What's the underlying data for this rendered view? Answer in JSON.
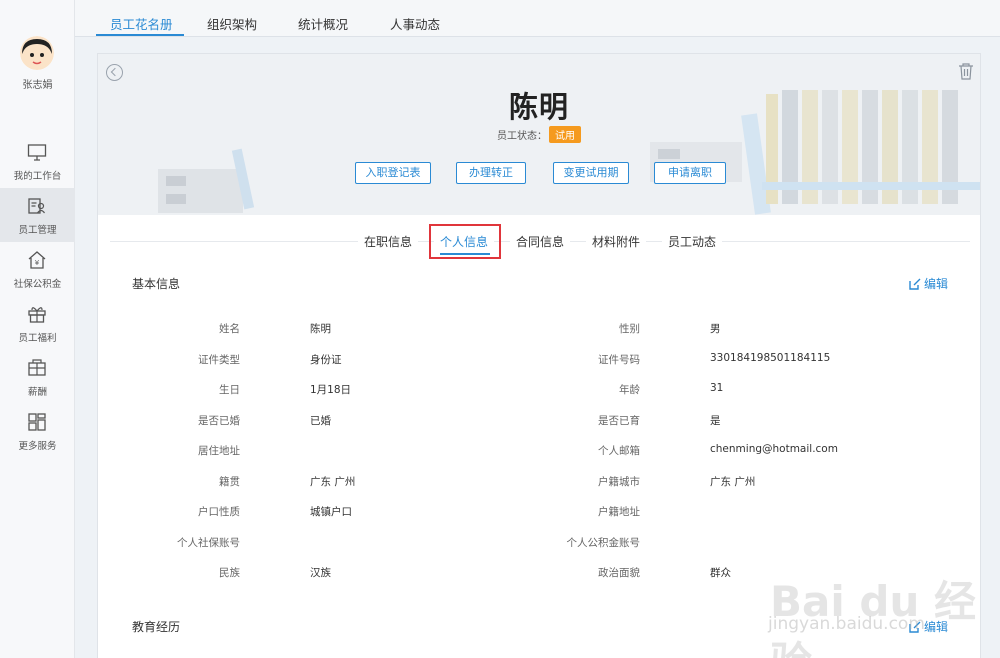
{
  "user": {
    "name": "张志娟"
  },
  "sidebar": {
    "items": [
      {
        "label": "我的工作台",
        "icon": "monitor-icon"
      },
      {
        "label": "员工管理",
        "icon": "employee-icon"
      },
      {
        "label": "社保公积金",
        "icon": "house-icon"
      },
      {
        "label": "员工福利",
        "icon": "gift-icon"
      },
      {
        "label": "薪酬",
        "icon": "wallet-icon"
      },
      {
        "label": "更多服务",
        "icon": "grid-icon"
      }
    ]
  },
  "top_tabs": [
    "员工花名册",
    "组织架构",
    "统计概况",
    "人事动态"
  ],
  "employee": {
    "name": "陈明",
    "status_label": "员工状态：",
    "status_badge": "试用"
  },
  "actions": [
    "入职登记表",
    "办理转正",
    "变更试用期",
    "申请离职"
  ],
  "sub_tabs": [
    "在职信息",
    "个人信息",
    "合同信息",
    "材料附件",
    "员工动态"
  ],
  "basic_info": {
    "title": "基本信息",
    "edit_label": "编辑",
    "rows": [
      {
        "l1": "姓名",
        "v1": "陈明",
        "l2": "性别",
        "v2": "男"
      },
      {
        "l1": "证件类型",
        "v1": "身份证",
        "l2": "证件号码",
        "v2": "330184198501184115"
      },
      {
        "l1": "生日",
        "v1": "1月18日",
        "l2": "年龄",
        "v2": "31"
      },
      {
        "l1": "是否已婚",
        "v1": "已婚",
        "l2": "是否已育",
        "v2": "是"
      },
      {
        "l1": "居住地址",
        "v1": "",
        "l2": "个人邮箱",
        "v2": "chenming@hotmail.com"
      },
      {
        "l1": "籍贯",
        "v1": "广东  广州",
        "l2": "户籍城市",
        "v2": "广东  广州"
      },
      {
        "l1": "户口性质",
        "v1": "城镇户口",
        "l2": "户籍地址",
        "v2": ""
      },
      {
        "l1": "个人社保账号",
        "v1": "",
        "l2": "个人公积金账号",
        "v2": ""
      },
      {
        "l1": "民族",
        "v1": "汉族",
        "l2": "政治面貌",
        "v2": "群众"
      }
    ]
  },
  "education": {
    "title": "教育经历",
    "edit_label": "编辑"
  },
  "watermark": {
    "main": "Bai du 经验",
    "sub": "jingyan.baidu.com"
  },
  "colors": {
    "accent": "#2a8ad4",
    "status": "#f59a1e",
    "highlight": "#e0353b"
  }
}
